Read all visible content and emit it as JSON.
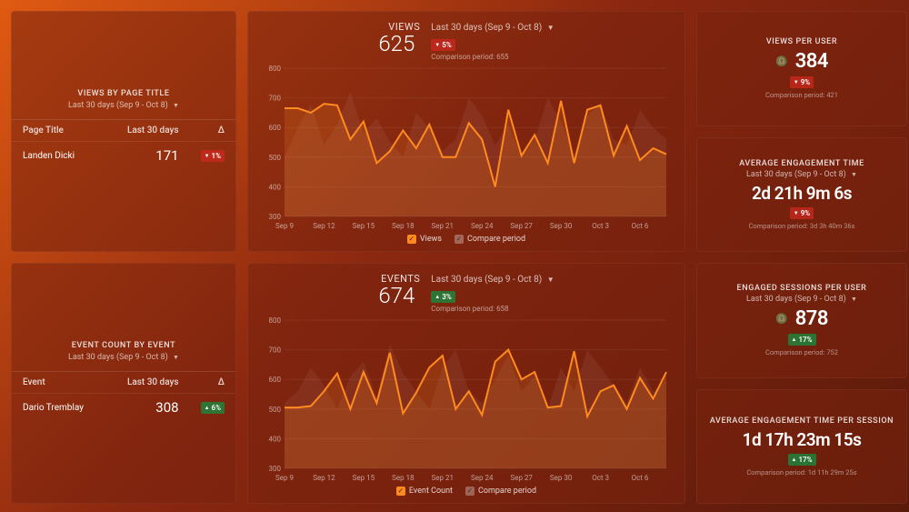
{
  "period_label": "Last 30 days (Sep 9 - Oct 8)",
  "comparison_prefix": "Comparison period:",
  "views_table": {
    "title": "VIEWS BY PAGE TITLE",
    "col1": "Page Title",
    "col2": "Last 30 days",
    "col3": "Δ",
    "row_name": "Landen Dicki",
    "row_value": "171",
    "row_delta_dir": "down",
    "row_delta": "1%"
  },
  "events_table": {
    "title": "EVENT COUNT BY EVENT",
    "col1": "Event",
    "col2": "Last 30 days",
    "col3": "Δ",
    "row_name": "Dario Tremblay",
    "row_value": "308",
    "row_delta_dir": "up",
    "row_delta": "6%"
  },
  "views_chart": {
    "label": "VIEWS",
    "value": "625",
    "delta_dir": "down",
    "delta": "5%",
    "comparison": "655",
    "legend_main": "Views",
    "legend_compare": "Compare period"
  },
  "events_chart": {
    "label": "EVENTS",
    "value": "674",
    "delta_dir": "up",
    "delta": "3%",
    "comparison": "658",
    "legend_main": "Event Count",
    "legend_compare": "Compare period"
  },
  "stat_views_user": {
    "title": "VIEWS PER USER",
    "value": "384",
    "delta_dir": "down",
    "delta": "9%",
    "comparison": "421"
  },
  "stat_eng_time": {
    "title": "AVERAGE ENGAGEMENT TIME",
    "value": "2d 21h 9m 6s",
    "delta_dir": "down",
    "delta": "9%",
    "comparison": "3d 3h 40m 36s"
  },
  "stat_sessions_user": {
    "title": "ENGAGED SESSIONS PER USER",
    "value": "878",
    "delta_dir": "up",
    "delta": "17%",
    "comparison": "752"
  },
  "stat_eng_time_session": {
    "title": "AVERAGE ENGAGEMENT TIME PER SESSION",
    "value": "1d 17h 23m 15s",
    "delta_dir": "up",
    "delta": "17%",
    "comparison": "1d 11h 29m 25s"
  },
  "chart_data": [
    {
      "type": "line",
      "title": "VIEWS",
      "ylabel": "",
      "xlabel": "",
      "ylim": [
        300,
        800
      ],
      "x_tick_labels": [
        "Sep 9",
        "Sep 12",
        "Sep 15",
        "Sep 18",
        "Sep 21",
        "Sep 24",
        "Sep 27",
        "Sep 30",
        "Oct 3",
        "Oct 6"
      ],
      "y_ticks": [
        300,
        400,
        500,
        600,
        700,
        800
      ],
      "series": [
        {
          "name": "Views",
          "values": [
            665,
            665,
            650,
            680,
            675,
            560,
            620,
            480,
            520,
            590,
            530,
            610,
            500,
            500,
            615,
            560,
            400,
            660,
            505,
            575,
            480,
            690,
            480,
            660,
            675,
            505,
            605,
            490,
            530,
            510
          ]
        },
        {
          "name": "Compare period",
          "values": [
            500,
            600,
            680,
            540,
            610,
            720,
            580,
            630,
            550,
            500,
            650,
            600,
            520,
            560,
            700,
            640,
            540,
            610,
            500,
            560,
            700,
            620,
            510,
            640,
            680,
            560,
            540,
            660,
            600,
            560
          ]
        }
      ]
    },
    {
      "type": "line",
      "title": "EVENTS",
      "ylabel": "",
      "xlabel": "",
      "ylim": [
        300,
        800
      ],
      "x_tick_labels": [
        "Sep 9",
        "Sep 12",
        "Sep 15",
        "Sep 18",
        "Sep 21",
        "Sep 24",
        "Sep 27",
        "Sep 30",
        "Oct 3",
        "Oct 6"
      ],
      "y_ticks": [
        300,
        400,
        500,
        600,
        700,
        800
      ],
      "series": [
        {
          "name": "Event Count",
          "values": [
            505,
            505,
            510,
            560,
            620,
            500,
            625,
            520,
            690,
            485,
            555,
            640,
            680,
            500,
            560,
            480,
            660,
            700,
            600,
            625,
            505,
            510,
            695,
            475,
            560,
            580,
            500,
            605,
            535,
            625
          ]
        },
        {
          "name": "Compare period",
          "values": [
            520,
            560,
            640,
            580,
            500,
            610,
            660,
            540,
            720,
            620,
            560,
            500,
            640,
            700,
            560,
            520,
            600,
            680,
            560,
            610,
            500,
            640,
            560,
            700,
            640,
            580,
            520,
            640,
            560,
            600
          ]
        }
      ]
    }
  ]
}
